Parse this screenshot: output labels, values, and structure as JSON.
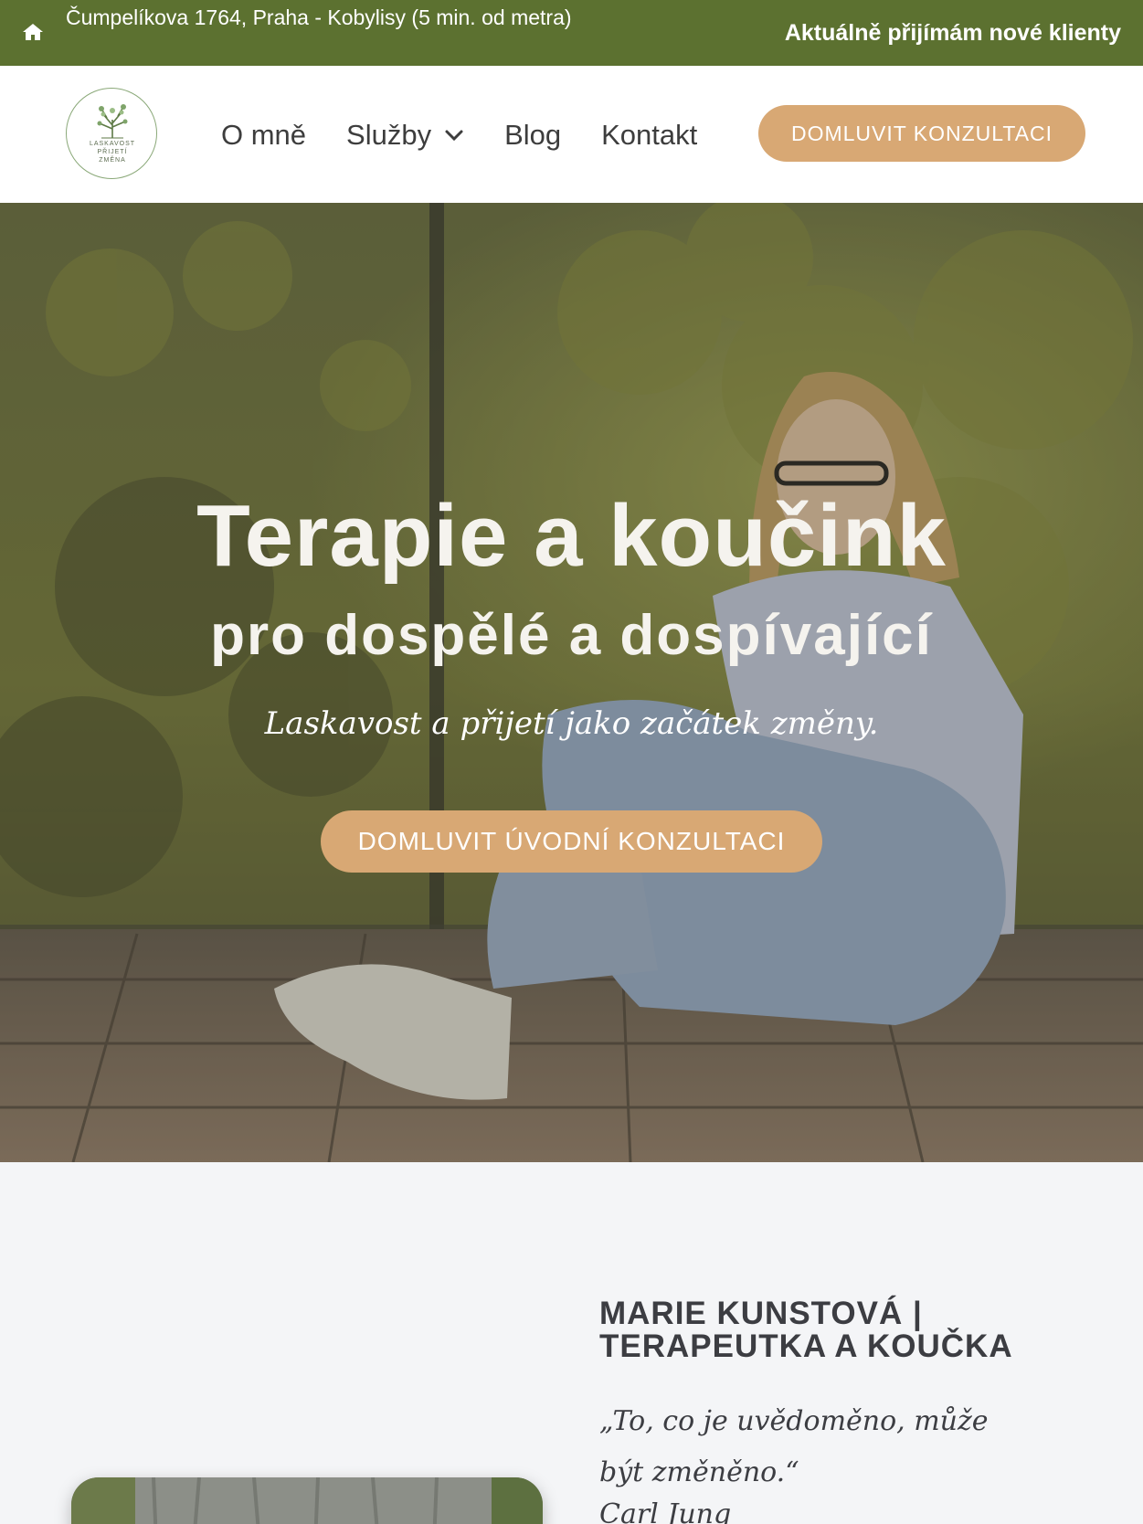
{
  "topbar": {
    "address": "Čumpelíkova 1764, Praha - Kobylisy (5 min. od metra)",
    "notice": "Aktuálně přijímám nové klienty",
    "icon": "home-icon"
  },
  "logo": {
    "lines": [
      "LASKAVOST",
      "PŘIJETÍ",
      "ZMĚNA"
    ]
  },
  "nav": {
    "items": [
      {
        "label": "O mně"
      },
      {
        "label": "Služby",
        "has_dropdown": true
      },
      {
        "label": "Blog"
      },
      {
        "label": "Kontakt"
      }
    ],
    "cta": "DOMLUVIT KONZULTACI"
  },
  "hero": {
    "title": "Terapie a koučink",
    "subtitle": "pro dospělé a dospívající",
    "tagline": "Laskavost a přijetí jako začátek změny.",
    "cta": "DOMLUVIT ÚVODNÍ KONZULTACI"
  },
  "about": {
    "title": "MARIE KUNSTOVÁ | TERAPEUTKA A KOUČKA",
    "quote": "„To, co je uvědoměno, může být změněno.“",
    "author": "Carl Jung"
  },
  "colors": {
    "topbar": "#5c7130",
    "accent": "#d8a874",
    "text": "#3c3d42",
    "background": "#f4f5f7"
  }
}
